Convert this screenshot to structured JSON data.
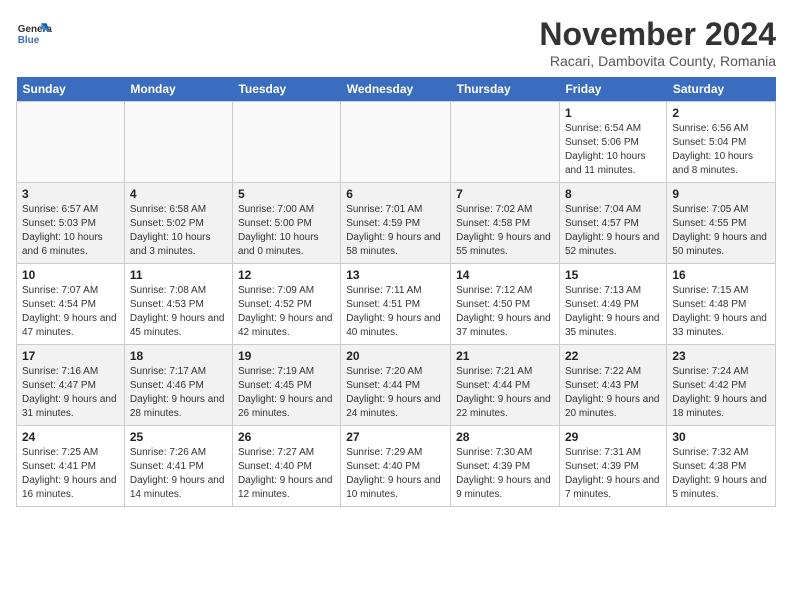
{
  "header": {
    "logo_line1": "General",
    "logo_line2": "Blue",
    "month": "November 2024",
    "location": "Racari, Dambovita County, Romania"
  },
  "weekdays": [
    "Sunday",
    "Monday",
    "Tuesday",
    "Wednesday",
    "Thursday",
    "Friday",
    "Saturday"
  ],
  "weeks": [
    [
      {
        "day": "",
        "info": ""
      },
      {
        "day": "",
        "info": ""
      },
      {
        "day": "",
        "info": ""
      },
      {
        "day": "",
        "info": ""
      },
      {
        "day": "",
        "info": ""
      },
      {
        "day": "1",
        "info": "Sunrise: 6:54 AM\nSunset: 5:06 PM\nDaylight: 10 hours and 11 minutes."
      },
      {
        "day": "2",
        "info": "Sunrise: 6:56 AM\nSunset: 5:04 PM\nDaylight: 10 hours and 8 minutes."
      }
    ],
    [
      {
        "day": "3",
        "info": "Sunrise: 6:57 AM\nSunset: 5:03 PM\nDaylight: 10 hours and 6 minutes."
      },
      {
        "day": "4",
        "info": "Sunrise: 6:58 AM\nSunset: 5:02 PM\nDaylight: 10 hours and 3 minutes."
      },
      {
        "day": "5",
        "info": "Sunrise: 7:00 AM\nSunset: 5:00 PM\nDaylight: 10 hours and 0 minutes."
      },
      {
        "day": "6",
        "info": "Sunrise: 7:01 AM\nSunset: 4:59 PM\nDaylight: 9 hours and 58 minutes."
      },
      {
        "day": "7",
        "info": "Sunrise: 7:02 AM\nSunset: 4:58 PM\nDaylight: 9 hours and 55 minutes."
      },
      {
        "day": "8",
        "info": "Sunrise: 7:04 AM\nSunset: 4:57 PM\nDaylight: 9 hours and 52 minutes."
      },
      {
        "day": "9",
        "info": "Sunrise: 7:05 AM\nSunset: 4:55 PM\nDaylight: 9 hours and 50 minutes."
      }
    ],
    [
      {
        "day": "10",
        "info": "Sunrise: 7:07 AM\nSunset: 4:54 PM\nDaylight: 9 hours and 47 minutes."
      },
      {
        "day": "11",
        "info": "Sunrise: 7:08 AM\nSunset: 4:53 PM\nDaylight: 9 hours and 45 minutes."
      },
      {
        "day": "12",
        "info": "Sunrise: 7:09 AM\nSunset: 4:52 PM\nDaylight: 9 hours and 42 minutes."
      },
      {
        "day": "13",
        "info": "Sunrise: 7:11 AM\nSunset: 4:51 PM\nDaylight: 9 hours and 40 minutes."
      },
      {
        "day": "14",
        "info": "Sunrise: 7:12 AM\nSunset: 4:50 PM\nDaylight: 9 hours and 37 minutes."
      },
      {
        "day": "15",
        "info": "Sunrise: 7:13 AM\nSunset: 4:49 PM\nDaylight: 9 hours and 35 minutes."
      },
      {
        "day": "16",
        "info": "Sunrise: 7:15 AM\nSunset: 4:48 PM\nDaylight: 9 hours and 33 minutes."
      }
    ],
    [
      {
        "day": "17",
        "info": "Sunrise: 7:16 AM\nSunset: 4:47 PM\nDaylight: 9 hours and 31 minutes."
      },
      {
        "day": "18",
        "info": "Sunrise: 7:17 AM\nSunset: 4:46 PM\nDaylight: 9 hours and 28 minutes."
      },
      {
        "day": "19",
        "info": "Sunrise: 7:19 AM\nSunset: 4:45 PM\nDaylight: 9 hours and 26 minutes."
      },
      {
        "day": "20",
        "info": "Sunrise: 7:20 AM\nSunset: 4:44 PM\nDaylight: 9 hours and 24 minutes."
      },
      {
        "day": "21",
        "info": "Sunrise: 7:21 AM\nSunset: 4:44 PM\nDaylight: 9 hours and 22 minutes."
      },
      {
        "day": "22",
        "info": "Sunrise: 7:22 AM\nSunset: 4:43 PM\nDaylight: 9 hours and 20 minutes."
      },
      {
        "day": "23",
        "info": "Sunrise: 7:24 AM\nSunset: 4:42 PM\nDaylight: 9 hours and 18 minutes."
      }
    ],
    [
      {
        "day": "24",
        "info": "Sunrise: 7:25 AM\nSunset: 4:41 PM\nDaylight: 9 hours and 16 minutes."
      },
      {
        "day": "25",
        "info": "Sunrise: 7:26 AM\nSunset: 4:41 PM\nDaylight: 9 hours and 14 minutes."
      },
      {
        "day": "26",
        "info": "Sunrise: 7:27 AM\nSunset: 4:40 PM\nDaylight: 9 hours and 12 minutes."
      },
      {
        "day": "27",
        "info": "Sunrise: 7:29 AM\nSunset: 4:40 PM\nDaylight: 9 hours and 10 minutes."
      },
      {
        "day": "28",
        "info": "Sunrise: 7:30 AM\nSunset: 4:39 PM\nDaylight: 9 hours and 9 minutes."
      },
      {
        "day": "29",
        "info": "Sunrise: 7:31 AM\nSunset: 4:39 PM\nDaylight: 9 hours and 7 minutes."
      },
      {
        "day": "30",
        "info": "Sunrise: 7:32 AM\nSunset: 4:38 PM\nDaylight: 9 hours and 5 minutes."
      }
    ]
  ]
}
